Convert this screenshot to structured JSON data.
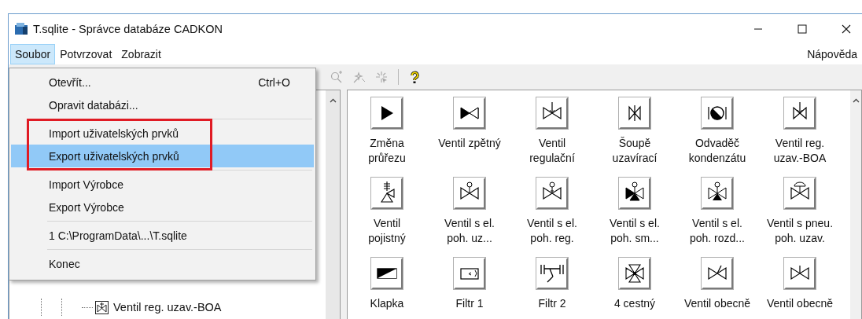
{
  "window": {
    "title": "T.sqlite - Správce databáze CADKON"
  },
  "menu_bar": [
    {
      "label": "Soubor",
      "selected": true
    },
    {
      "label": "Potvrzovat",
      "selected": false
    },
    {
      "label": "Zobrazit",
      "selected": false
    },
    {
      "label": "Nápověda",
      "selected": false,
      "right_aligned": true
    }
  ],
  "toolbar": [
    {
      "kind": "zoom",
      "disabled": true
    },
    {
      "kind": "wand",
      "disabled": true
    },
    {
      "kind": "cursor",
      "disabled": true
    },
    {
      "kind": "separator"
    },
    {
      "kind": "help"
    }
  ],
  "file_menu": [
    {
      "kind": "item",
      "label": "Otevřít...",
      "shortcut": "Ctrl+O",
      "selected": false,
      "outlined": false
    },
    {
      "kind": "item",
      "label": "Opravit databázi...",
      "selected": false,
      "outlined": false
    },
    {
      "kind": "separator"
    },
    {
      "kind": "item",
      "label": "Import uživatelských prvků",
      "selected": false,
      "outlined": true
    },
    {
      "kind": "item",
      "label": "Export uživatelských prvků",
      "selected": true,
      "outlined": true
    },
    {
      "kind": "separator"
    },
    {
      "kind": "item",
      "label": "Import Výrobce",
      "selected": false,
      "outlined": false
    },
    {
      "kind": "item",
      "label": "Export Výrobce",
      "selected": false,
      "outlined": false
    },
    {
      "kind": "separator"
    },
    {
      "kind": "item",
      "label": "1 C:\\ProgramData\\...\\T.sqlite",
      "selected": false,
      "outlined": false
    },
    {
      "kind": "separator"
    },
    {
      "kind": "item",
      "label": "Konec",
      "selected": false,
      "outlined": false
    }
  ],
  "tree": {
    "items": [
      {
        "label": "Ventil reg. uzav.-BOA"
      }
    ]
  },
  "elements": [
    {
      "label": "Změna\nprůřezu"
    },
    {
      "label": "Ventil zpětný"
    },
    {
      "label": "Ventil\nregulační"
    },
    {
      "label": "Šoupě\nuzavírací"
    },
    {
      "label": "Odvaděč\nkondenzátu"
    },
    {
      "label": "Ventil reg.\nuzav.-BOA"
    },
    {
      "label": "Ventil\npojistný"
    },
    {
      "label": "Ventil s el.\npoh. uz..."
    },
    {
      "label": "Ventil s el.\npoh. reg."
    },
    {
      "label": "Ventil s el.\npoh. sm..."
    },
    {
      "label": "Ventil s el.\npoh. rozd..."
    },
    {
      "label": "Ventil s pneu.\npoh. uzav."
    },
    {
      "label": "Klapka"
    },
    {
      "label": "Filtr 1"
    },
    {
      "label": "Filtr 2"
    },
    {
      "label": "4 cestný"
    },
    {
      "label": "Ventil obecně"
    },
    {
      "label": "Ventil obecně"
    }
  ]
}
